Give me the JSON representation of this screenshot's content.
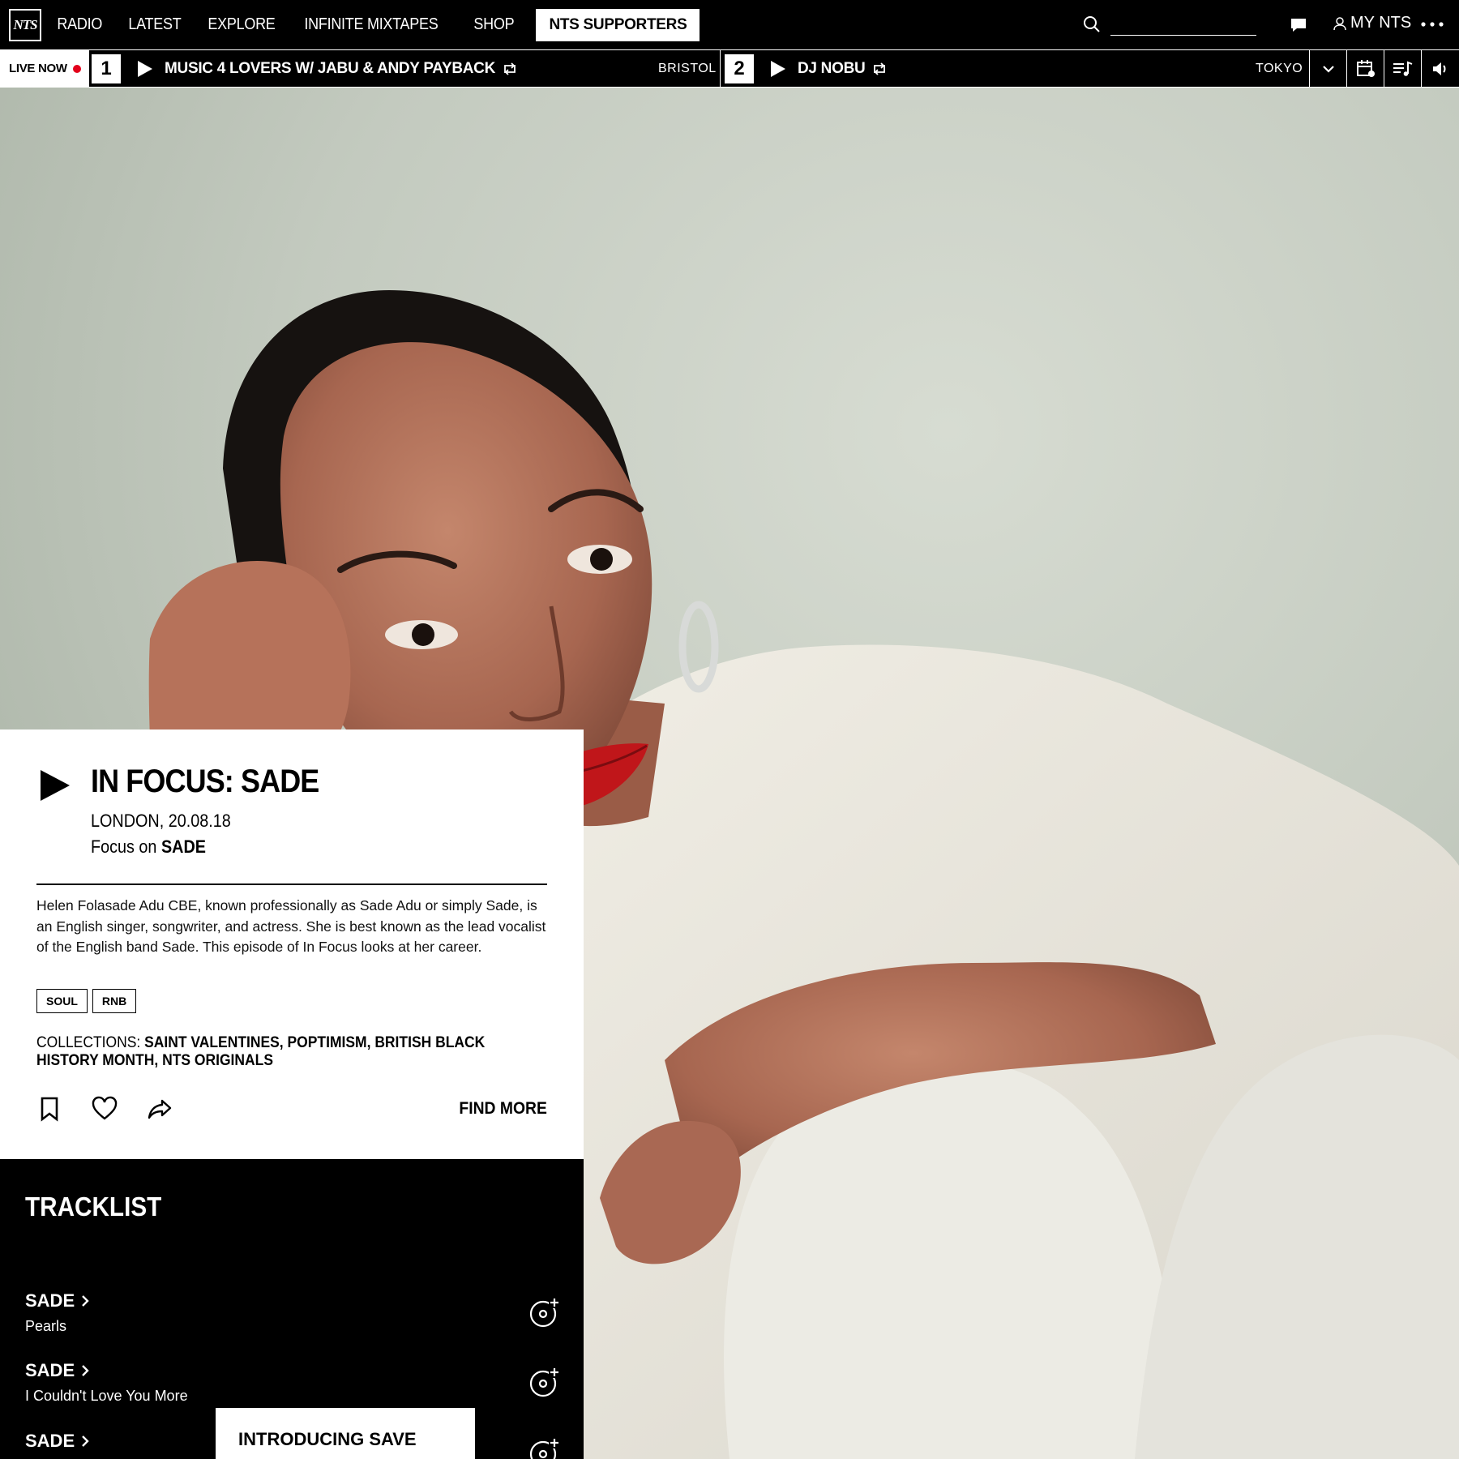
{
  "nav": {
    "logo": "NTS",
    "links": [
      "RADIO",
      "LATEST",
      "EXPLORE",
      "INFINITE MIXTAPES",
      "SHOP"
    ],
    "supporters": "NTS SUPPORTERS",
    "search_placeholder": "",
    "my_nts": "MY NTS"
  },
  "live": {
    "label": "LIVE NOW",
    "channels": [
      {
        "number": "1",
        "title": "MUSIC 4 LOVERS W/ JABU & ANDY PAYBACK",
        "location": "BRISTOL"
      },
      {
        "number": "2",
        "title": "DJ NOBU",
        "location": "TOKYO"
      }
    ]
  },
  "episode": {
    "title": "IN FOCUS: SADE",
    "meta": "LONDON, 20.08.18",
    "focus_prefix": "Focus on",
    "focus_name": "SADE",
    "description": "Helen Folasade Adu CBE, known professionally as Sade Adu or simply Sade, is an English singer, songwriter, and actress. She is best known as the lead vocalist of the English band Sade. This episode of In Focus looks at her career.",
    "tags": [
      "SOUL",
      "RNB"
    ],
    "collections_label": "COLLECTIONS:",
    "collections": "SAINT VALENTINES, POPTIMISM, BRITISH BLACK HISTORY MONTH, NTS ORIGINALS",
    "find_more": "FIND MORE"
  },
  "tracklist": {
    "heading": "TRACKLIST",
    "tracks": [
      {
        "artist": "SADE",
        "title": "Pearls"
      },
      {
        "artist": "SADE",
        "title": "I Couldn't Love You More"
      },
      {
        "artist": "SADE",
        "title": ""
      }
    ]
  },
  "popup": {
    "label": "INTRODUCING SAVE"
  },
  "colors": {
    "live_dot": "#e3001b",
    "background": "#000000",
    "card": "#ffffff"
  }
}
